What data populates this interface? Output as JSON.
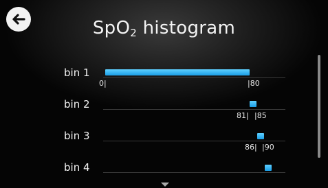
{
  "header": {
    "title_prefix": "SpO",
    "title_sub": "2",
    "title_suffix": " histogram"
  },
  "icons": {
    "back": "back-arrow-icon",
    "scroll_down": "chevron-down-icon"
  },
  "colors": {
    "bar": "#2aaae8",
    "background": "#000000"
  },
  "bins": [
    {
      "label": "bin 1",
      "range_low": "0",
      "range_high": "80",
      "level": 0.8
    },
    {
      "label": "bin 2",
      "range_low": "81",
      "range_high": "85",
      "level": 0.04
    },
    {
      "label": "bin 3",
      "range_low": "86",
      "range_high": "90",
      "level": 0.04
    },
    {
      "label": "bin 4",
      "range_low": "",
      "range_high": "",
      "level": 0.04
    }
  ]
}
